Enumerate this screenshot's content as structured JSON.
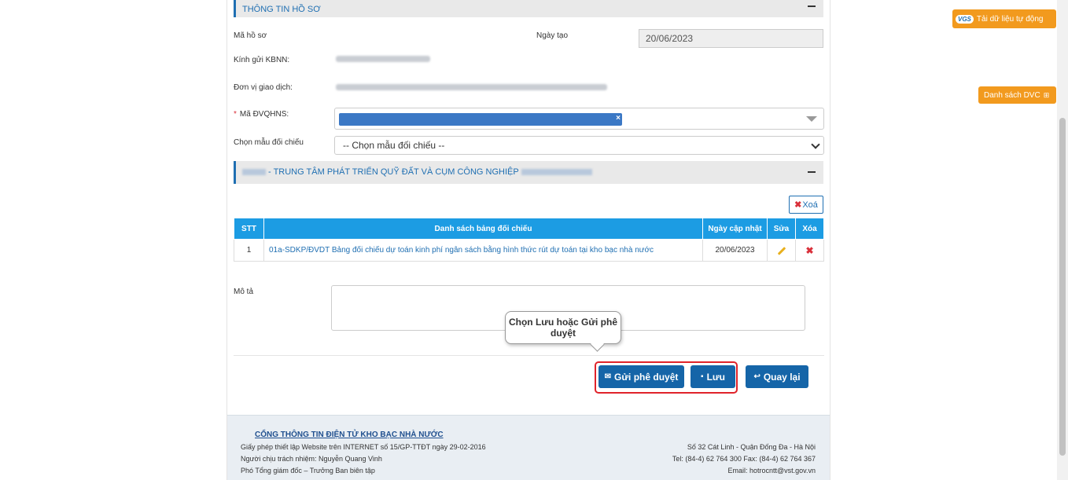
{
  "section1": {
    "title": "THÔNG TIN HỒ SƠ"
  },
  "labels": {
    "ma_ho_so": "Mã hồ sơ",
    "ngay_tao": "Ngày tạo",
    "kinh_gui": "Kính gửi KBNN:",
    "don_vi": "Đơn vị giao dịch:",
    "ma_dvqhns": "Mã ĐVQHNS:",
    "chon_mau": "Chọn mẫu đối chiếu",
    "mo_ta": "Mô tả"
  },
  "fields": {
    "ngay_tao_value": "20/06/2023",
    "chon_mau_value": "-- Chọn mẫu đối chiếu --"
  },
  "section2": {
    "title_suffix": " - TRUNG TÂM PHÁT TRIỂN QUỸ ĐẤT VÀ CỤM CÔNG NGHIỆP"
  },
  "xoa_button": "Xoá",
  "table": {
    "headers": [
      "STT",
      "Danh sách bảng đối chiếu",
      "Ngày cập nhật",
      "Sửa",
      "Xóa"
    ],
    "rows": [
      {
        "stt": "1",
        "name": "01a-SDKP/ĐVDT Bảng đối chiếu dự toán kinh phí ngân sách bằng hình thức rút dự toán tại kho bạc nhà nước",
        "date": "20/06/2023"
      }
    ]
  },
  "callout": "Chọn Lưu hoặc Gửi phê duyệt",
  "buttons": {
    "gui": "Gửi phê duyệt",
    "luu": "Lưu",
    "quay_lai": "Quay lại"
  },
  "side": {
    "tai_du_lieu": "Tải dữ liệu tự động",
    "danh_sach": "Danh sách DVC",
    "logo": "VGS"
  },
  "footer": {
    "title": "CỔNG THÔNG TIN ĐIỆN TỬ KHO BẠC NHÀ NƯỚC",
    "line1": "Giấy phép thiết lập Website trên INTERNET số 15/GP-TTĐT ngày 29-02-2016",
    "line2": "Người chịu trách nhiệm: Nguyễn Quang Vinh",
    "line3": "Phó Tổng giám đốc – Trưởng Ban biên tập",
    "addr": "Số 32 Cát Linh - Quận Đống Đa - Hà Nội",
    "tel": "Tel: (84-4) 62 764 300 Fax: (84-4) 62 764 367",
    "email": "Email: hotrocntt@vst.gov.vn"
  }
}
